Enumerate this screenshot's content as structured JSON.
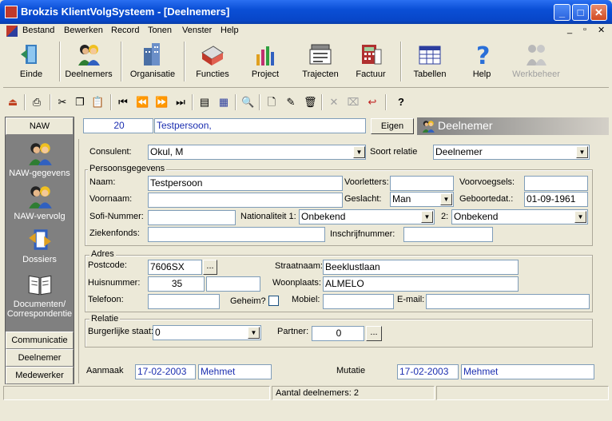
{
  "window": {
    "app": "Brokzis",
    "title": "Brokzis  KlientVolgSysteem - [Deelnemers]"
  },
  "menu": [
    "Bestand",
    "Bewerken",
    "Record",
    "Tonen",
    "Venster",
    "Help"
  ],
  "toolbar": [
    {
      "label": "Einde",
      "icon": "exit-door-icon"
    },
    {
      "label": "Deelnemers",
      "icon": "people-icon"
    },
    {
      "label": "Organisatie",
      "icon": "building-icon"
    },
    {
      "label": "Functies",
      "icon": "functions-icon"
    },
    {
      "label": "Project",
      "icon": "project-icon"
    },
    {
      "label": "Trajecten",
      "icon": "trajecten-icon"
    },
    {
      "label": "Factuur",
      "icon": "invoice-calculator-icon"
    },
    {
      "label": "Tabellen",
      "icon": "tables-icon"
    },
    {
      "label": "Help",
      "icon": "help-question-icon"
    },
    {
      "label": "Werkbeheer",
      "icon": "werkbeheer-icon"
    }
  ],
  "leftnav": {
    "header": "NAW",
    "items": [
      {
        "label": "NAW-gegevens",
        "icon": "people-icon"
      },
      {
        "label": "NAW-vervolg",
        "icon": "people-icon"
      },
      {
        "label": "Dossiers",
        "icon": "dossiers-icon"
      },
      {
        "label": "Documenten/ Correspondentie",
        "icon": "book-icon"
      }
    ],
    "footer": [
      "Communicatie",
      "Deelnemer",
      "Medewerker"
    ]
  },
  "record": {
    "id": "20",
    "name": "Testpersoon,",
    "eigen_button": "Eigen",
    "panel_title": "Deelnemer"
  },
  "form": {
    "consulent_label": "Consulent:",
    "consulent": "Okul, M",
    "soort_relatie_label": "Soort relatie",
    "soort_relatie": "Deelnemer",
    "persoonsgegevens_title": "Persoonsgegevens",
    "naam_label": "Naam:",
    "naam": "Testpersoon",
    "voorletters_label": "Voorletters:",
    "voorletters": "",
    "voorvoegsels_label": "Voorvoegsels:",
    "voorvoegsels": "",
    "voornaam_label": "Voornaam:",
    "voornaam": "",
    "geslacht_label": "Geslacht:",
    "geslacht": "Man",
    "geboortedat_label": "Geboortedat.:",
    "geboortedat": "01-09-1961",
    "sofi_label": "Sofi-Nummer:",
    "sofi": "",
    "nationaliteit1_label": "Nationaliteit 1:",
    "nationaliteit1": "Onbekend",
    "nationaliteit2_label": "2:",
    "nationaliteit2": "Onbekend",
    "ziekenfonds_label": "Ziekenfonds:",
    "ziekenfonds": "",
    "inschrijf_label": "Inschrijfnummer:",
    "inschrijf": "",
    "adres_title": "Adres",
    "postcode_label": "Postcode:",
    "postcode": "7606SX",
    "ellipsis": "...",
    "straatnaam_label": "Straatnaam:",
    "straatnaam": "Beeklustlaan",
    "huisnummer_label": "Huisnummer:",
    "huisnummer": "35",
    "toevoeging": "",
    "woonplaats_label": "Woonplaats:",
    "woonplaats": "ALMELO",
    "telefoon_label": "Telefoon:",
    "telefoon": "",
    "geheim_label": "Geheim?",
    "mobiel_label": "Mobiel:",
    "mobiel": "",
    "email_label": "E-mail:",
    "email": "",
    "relatie_title": "Relatie",
    "burgerlijke_label": "Burgerlijke staat:",
    "burgerlijke": "0",
    "partner_label": "Partner:",
    "partner": "0",
    "aanmaak_label": "Aanmaak",
    "aanmaak_date": "17-02-2003",
    "aanmaak_user": "Mehmet",
    "mutatie_label": "Mutatie",
    "mutatie_date": "17-02-2003",
    "mutatie_user": "Mehmet"
  },
  "status": {
    "count": "Aantal deelnemers: 2"
  }
}
